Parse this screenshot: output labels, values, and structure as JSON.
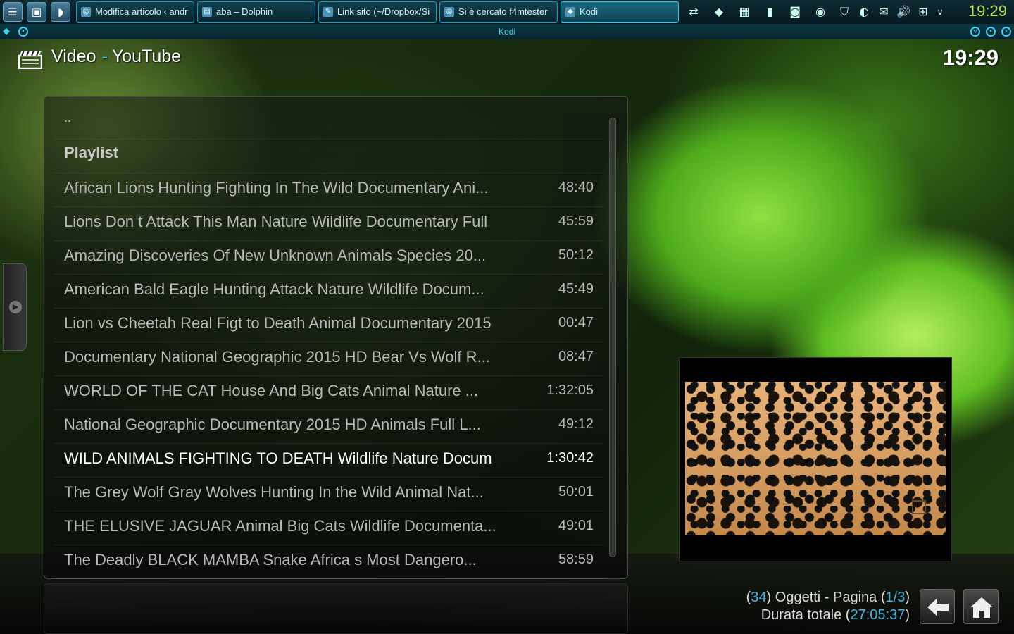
{
  "taskbar": {
    "tasks": [
      {
        "label": "Modifica articolo ‹ andr",
        "icon": "browser-icon"
      },
      {
        "label": "aba – Dolphin",
        "icon": "folder-icon"
      },
      {
        "label": "Link sito (~/Dropbox/Si",
        "icon": "editor-icon"
      },
      {
        "label": "Si è cercato f4mtester",
        "icon": "browser-icon"
      },
      {
        "label": "Kodi",
        "icon": "kodi-icon"
      }
    ],
    "clock": "19:29"
  },
  "window": {
    "title": "Kodi"
  },
  "header": {
    "section": "Video",
    "sep": "-",
    "addon": "YouTube",
    "clock": "19:29"
  },
  "list": {
    "updir": "..",
    "playlist_label": "Playlist",
    "items": [
      {
        "title": "African Lions Hunting Fighting In The Wild Documentary Ani...",
        "duration": "48:40"
      },
      {
        "title": "Lions Don t Attack This Man Nature Wildlife Documentary Full",
        "duration": "45:59"
      },
      {
        "title": "Amazing Discoveries Of New Unknown Animals Species 20...",
        "duration": "50:12"
      },
      {
        "title": "American Bald Eagle Hunting Attack Nature Wildlife Docum...",
        "duration": "45:49"
      },
      {
        "title": "Lion vs Cheetah Real Figt to Death   Animal Documentary 2015",
        "duration": "00:47"
      },
      {
        "title": "Documentary National Geographic 2015 HD Bear Vs Wolf R...",
        "duration": "08:47"
      },
      {
        "title": "WORLD OF THE CAT   House And Big Cats Animal Nature ...",
        "duration": "1:32:05"
      },
      {
        "title": "National Geographic Documentary 2015 HD Animals Full   L...",
        "duration": "49:12"
      },
      {
        "title": "WILD ANIMALS FIGHTING TO DEATH Wildlife Nature Docum",
        "duration": "1:30:42"
      },
      {
        "title": "The Grey Wolf   Gray Wolves Hunting In the Wild Animal Nat...",
        "duration": "50:01"
      },
      {
        "title": "THE ELUSIVE JAGUAR Animal Big Cats Wildlife Documenta...",
        "duration": "49:01"
      },
      {
        "title": "The Deadly BLACK MAMBA Snake   Africa s Most Dangero...",
        "duration": "58:59"
      }
    ],
    "selected_index": 8
  },
  "footer": {
    "count": "34",
    "objects_label": "Oggetti - Pagina",
    "page": "1/3",
    "total_label": "Durata totale",
    "total": "27:05:37"
  },
  "colors": {
    "accent": "#3fb8e8",
    "taskbar_clock": "#b7e24a"
  }
}
